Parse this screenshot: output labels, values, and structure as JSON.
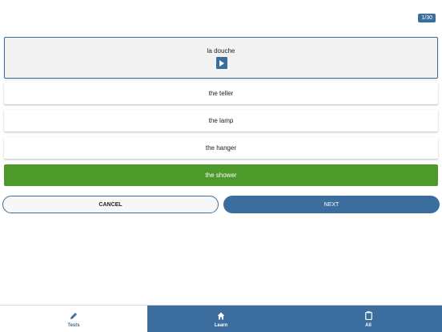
{
  "progress": "1/30",
  "question": {
    "word": "la douche",
    "play_icon": "play-icon"
  },
  "answers": [
    {
      "label": "the teller",
      "state": "default"
    },
    {
      "label": "the lamp",
      "state": "default"
    },
    {
      "label": "the hanger",
      "state": "default"
    },
    {
      "label": "the shower",
      "state": "correct"
    }
  ],
  "actions": {
    "cancel_label": "CANCEL",
    "next_label": "NEXT"
  },
  "tabs": [
    {
      "label": "Tests",
      "icon": "pencil-icon",
      "active": true
    },
    {
      "label": "Learn",
      "icon": "home-icon",
      "active": false
    },
    {
      "label": "All",
      "icon": "clipboard-icon",
      "active": false
    }
  ],
  "colors": {
    "primary": "#3b6e9f",
    "correct": "#4c9a2a"
  }
}
